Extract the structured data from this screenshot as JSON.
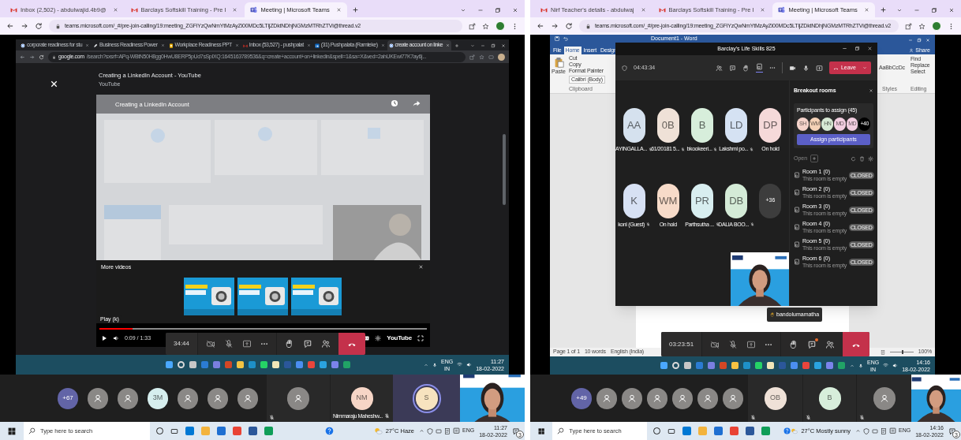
{
  "left": {
    "tabs": [
      {
        "label": "Inbox (2,502) - abdulwajid.4b9@",
        "kind": "gmail",
        "selected": false
      },
      {
        "label": "Barclays Softskill Training - Pre I",
        "kind": "gmail",
        "selected": false
      },
      {
        "label": "Meeting | Microsoft Teams",
        "kind": "teams",
        "selected": true
      }
    ],
    "address": "teams.microsoft.com/_#/pre-join-calling/19:meeting_ZGFiYzQwNmYtMzAyZi00MDc5LTljZDktNDhjNGMzMTRhZTVi@thread.v2",
    "shared_browser": {
      "tabs": [
        {
          "label": "corporate readiness for stu",
          "kind": "google",
          "selected": false
        },
        {
          "label": "Business Readiness Power",
          "kind": "pen",
          "selected": false
        },
        {
          "label": "Workplace Readiness PPT",
          "kind": "slides",
          "selected": false
        },
        {
          "label": "Inbox (53,527) - pushpalat",
          "kind": "gmail",
          "selected": false
        },
        {
          "label": "(31) Pushpalata (Ramteke)",
          "kind": "linkedin",
          "selected": false
        },
        {
          "label": "create account on linke",
          "kind": "google",
          "selected": true
        }
      ],
      "address_host": "google.com",
      "address_path": "/search?sxsrf=APq-WBtN50H8gg0HwU8ERP5pUd7sSpIXQ:1645163789536&q=create+account+on+linkedin&spell=1&sa=X&ved=2ahUKEwi77K7ay6j...",
      "overlay_title": "Creating a LinkedIn Account - YouTube",
      "overlay_source": "YouTube",
      "video_title": "Creating a LinkedIn Account",
      "more_videos": "More videos",
      "tooltip": "Play (k)",
      "progress": {
        "level": 0.1
      },
      "time": "0:09 / 1:33",
      "player_logo": "YouTube"
    },
    "call_bar": {
      "timer": "34:44",
      "chat_badge": false
    },
    "shared_taskbar": {
      "language": "ENG",
      "region": "IN",
      "time": "11:27",
      "date": "18-02-2022"
    },
    "participants": {
      "avatars": [
        {
          "kind": "overflow",
          "label": "+67",
          "color": "#6264a7"
        },
        {
          "kind": "anonymous"
        },
        {
          "kind": "anonymous"
        },
        {
          "kind": "initials",
          "label": "3M",
          "color": "#d6eeee"
        },
        {
          "kind": "anonymous"
        },
        {
          "kind": "anonymous"
        },
        {
          "kind": "anonymous"
        }
      ],
      "tiles": [
        {
          "kind": "anonymous",
          "muted": true,
          "speaking": false
        },
        {
          "kind": "initials",
          "label": "NM",
          "color": "#f6d5c6",
          "name": "Nimmaraju Maheshw...",
          "muted": true,
          "speaking": false
        },
        {
          "kind": "initials",
          "label": "S",
          "color": "#f7e3bf",
          "muted": false,
          "speaking": true
        },
        {
          "kind": "video",
          "muted": false,
          "speaking": false
        }
      ]
    },
    "taskbar": {
      "search_placeholder": "Type here to search",
      "weather": "27°C Haze",
      "language": "ENG",
      "time": "11:27",
      "date": "18-02-2022",
      "notifications": "3"
    }
  },
  "right": {
    "tabs": [
      {
        "label": "Nirf Teacher's details - abdulwaj",
        "kind": "gmail",
        "selected": false
      },
      {
        "label": "Barclays Softskill Training - Pre I",
        "kind": "gmail",
        "selected": false
      },
      {
        "label": "Meeting | Microsoft Teams",
        "kind": "teams",
        "selected": true
      }
    ],
    "address": "teams.microsoft.com/_#/pre-join-calling/19:meeting_ZGFiYzQwNmYtMzAyZi00MDc5LTljZDktNDhjNGMzMTRhZTVi@thread.v2",
    "word": {
      "title": "Document1 - Word",
      "ribbon_tabs": [
        {
          "label": "File",
          "selected": false
        },
        {
          "label": "Home",
          "selected": true
        },
        {
          "label": "Insert",
          "selected": false
        },
        {
          "label": "Design",
          "selected": false
        }
      ],
      "share": "Share",
      "paste": "Paste",
      "clipboard": [
        "Cut",
        "Copy",
        "Format Painter"
      ],
      "clipboard_group": "Clipboard",
      "font": "Calibri (Body)",
      "style_sample": "AaBbCcDc",
      "styles_group": "Styles",
      "editing": [
        "Find",
        "Replace",
        "Select"
      ],
      "editing_group": "Editing",
      "status": [
        "Page 1 of 1",
        "10 words",
        "English (India)"
      ],
      "zoom_slider": {
        "level": 0.5
      },
      "zoom": "100%"
    },
    "meeting_window": {
      "title": "Barclay's Life Skills 825",
      "timer": "04:43:34",
      "leave": "Leave",
      "tiles": [
        {
          "initials": "AA",
          "color": "#d5e1ee",
          "name": "AYINGALLA...",
          "muted": true
        },
        {
          "initials": "0B",
          "color": "#efe1d7",
          "name": "61/20181 5...",
          "muted": true
        },
        {
          "initials": "B",
          "color": "#d7eedb",
          "name": "bkookeeri...",
          "muted": true
        },
        {
          "initials": "LD",
          "color": "#d5e2f3",
          "name": "Lakshmi po...",
          "muted": true
        },
        {
          "initials": "DP",
          "color": "#f5d9d9",
          "name": "On hold",
          "muted": false
        },
        {
          "initials": "K",
          "color": "#d7e1f4",
          "name": "konl (Guest)",
          "muted": true
        },
        {
          "initials": "WM",
          "color": "#f7dbc9",
          "name": "On hold",
          "muted": false
        },
        {
          "initials": "PR",
          "color": "#d8eef0",
          "name": "Parthsutha ...",
          "muted": true
        },
        {
          "initials": "DB",
          "color": "#d4ebd7",
          "name": "DALIA BOO...",
          "muted": true
        }
      ],
      "overflow": "+36",
      "breakout": {
        "title": "Breakout rooms",
        "assign_title": "Participants to assign (45)",
        "assignees": [
          {
            "initials": "SH",
            "color": "#f5d3cb"
          },
          {
            "initials": "WM",
            "color": "#f5d2b7"
          },
          {
            "initials": "HN",
            "color": "#d8ead5"
          },
          {
            "initials": "MD",
            "color": "#f2cee0"
          },
          {
            "initials": "MD",
            "color": "#f2cee0"
          }
        ],
        "assign_overflow": "+40",
        "assign_button": "Assign participants",
        "open_label": "Open",
        "rooms": [
          {
            "name": "Room 1 (0)",
            "status": "This room is empty",
            "badge": "CLOSED"
          },
          {
            "name": "Room 2 (0)",
            "status": "This room is empty",
            "badge": "CLOSED"
          },
          {
            "name": "Room 3 (0)",
            "status": "This room is empty",
            "badge": "CLOSED"
          },
          {
            "name": "Room 4 (0)",
            "status": "This room is empty",
            "badge": "CLOSED"
          },
          {
            "name": "Room 5 (0)",
            "status": "This room is empty",
            "badge": "CLOSED"
          },
          {
            "name": "Room 6 (0)",
            "status": "This room is empty",
            "badge": "CLOSED"
          }
        ]
      }
    },
    "tooltip": "bandolumamatha",
    "call_bar": {
      "timer": "03:23:51",
      "chat_badge": true
    },
    "shared_taskbar": {
      "language": "ENG",
      "region": "IN",
      "time": "14:16",
      "date": "18-02-2022"
    },
    "participants": {
      "avatars": [
        {
          "kind": "overflow",
          "label": "+49",
          "color": "#6264a7"
        },
        {
          "kind": "anonymous"
        },
        {
          "kind": "anonymous"
        },
        {
          "kind": "anonymous"
        },
        {
          "kind": "anonymous"
        },
        {
          "kind": "anonymous"
        },
        {
          "kind": "anonymous"
        }
      ],
      "tiles": [
        {
          "kind": "initials",
          "label": "OB",
          "color": "#efe1d7",
          "muted": true,
          "speaking": false
        },
        {
          "kind": "initials",
          "label": "B",
          "color": "#d7eedb",
          "muted": true,
          "speaking": false
        },
        {
          "kind": "anonymous",
          "muted": true,
          "speaking": false
        },
        {
          "kind": "video",
          "muted": false,
          "speaking": false
        }
      ]
    },
    "taskbar": {
      "search_placeholder": "Type here to search",
      "weather": "27°C Mostly sunny",
      "language": "ENG",
      "time": "14:16",
      "date": "18-02-2022",
      "notifications": "3"
    }
  }
}
